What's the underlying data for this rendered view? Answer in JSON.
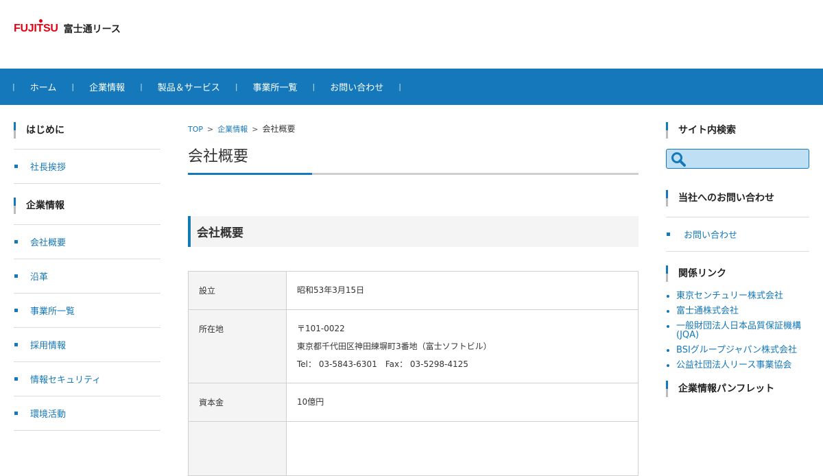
{
  "header": {
    "logo_mark": "FUJITSU",
    "company_name": "富士通リース"
  },
  "gnav": {
    "items": [
      {
        "label": "ホーム"
      },
      {
        "label": "企業情報"
      },
      {
        "label": "製品＆サービス"
      },
      {
        "label": "事業所一覧"
      },
      {
        "label": "お問い合わせ"
      }
    ],
    "separator": "|"
  },
  "left_nav": {
    "sections": [
      {
        "title": "はじめに",
        "items": [
          "社長挨拶"
        ]
      },
      {
        "title": "企業情報",
        "items": [
          "会社概要",
          "沿革",
          "事業所一覧",
          "採用情報",
          "情報セキュリティ",
          "環境活動"
        ]
      }
    ]
  },
  "breadcrumb": {
    "top": "TOP",
    "parent": "企業情報",
    "current": "会社概要",
    "separator": ">"
  },
  "main": {
    "page_title": "会社概要",
    "section_heading": "会社概要",
    "table": [
      {
        "label": "設立",
        "lines": [
          "昭和53年3月15日"
        ]
      },
      {
        "label": "所在地",
        "lines": [
          "〒101-0022",
          "東京都千代田区神田練塀町3番地（富士ソフトビル）",
          "Tel： 03-5843-6301　Fax： 03-5298-4125"
        ]
      },
      {
        "label": "資本金",
        "lines": [
          "10億円"
        ]
      }
    ]
  },
  "right_side": {
    "search_title": "サイト内検索",
    "search_placeholder": "",
    "contact_title": "当社へのお問い合わせ",
    "contact_link": "お問い合わせ",
    "links_title": "関係リンク",
    "links": [
      "東京センチュリー株式会社",
      "富士通株式会社",
      "一般財団法人日本品質保証機構(JQA)",
      "BSIグループジャパン株式会社",
      "公益社団法人リース事業協会"
    ],
    "pamphlet_title": "企業情報パンフレット"
  },
  "colors": {
    "brand_blue": "#1478ba",
    "logo_red": "#e60012"
  }
}
